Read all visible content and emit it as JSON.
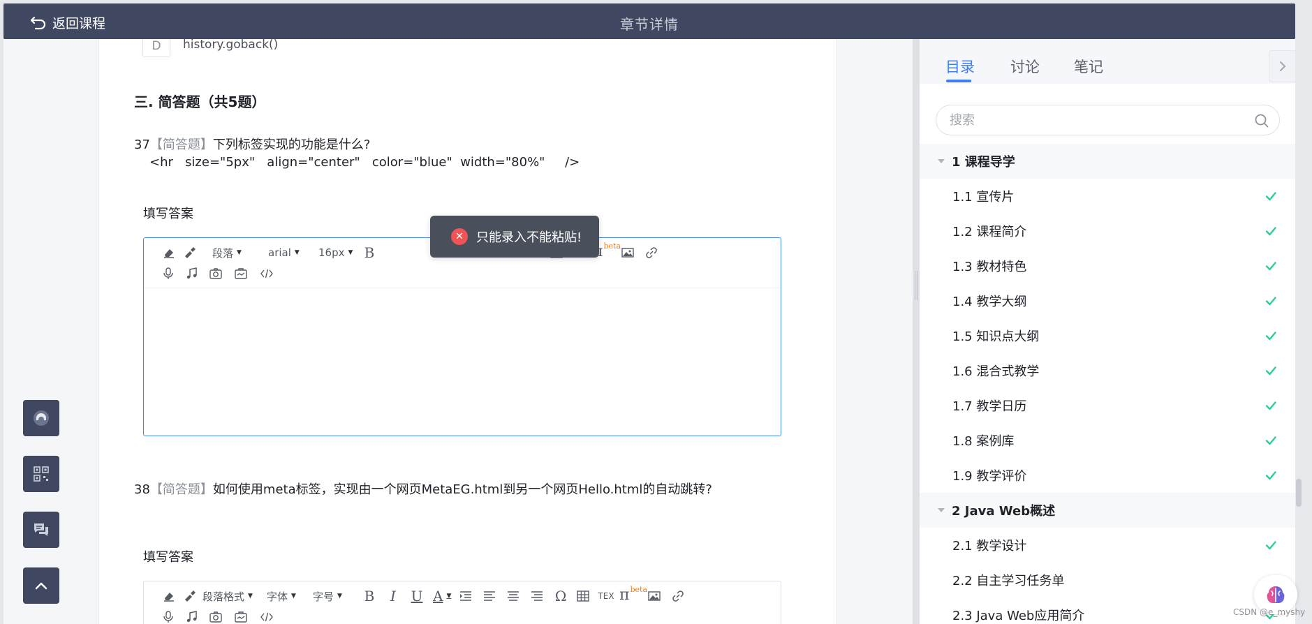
{
  "header": {
    "back_label": "返回课程",
    "title": "章节详情"
  },
  "content": {
    "prev_option": {
      "letter": "D",
      "text": "history.goback()"
    },
    "section_title": "三. 简答题（共5题）",
    "answer_label": "填写答案",
    "questions": [
      {
        "number": "37",
        "type": "【简答题】",
        "text": "下列标签实现的功能是什么?",
        "code": "<hr   size=\"5px\"   align=\"center\"   color=\"blue\"  width=\"80%\"     />"
      },
      {
        "number": "38",
        "type": "【简答题】",
        "text": "如何使用meta标签，实现由一个网页MetaEG.html到另一个网页Hello.html的自动跳转?"
      }
    ]
  },
  "editor1": {
    "paragraph": "段落",
    "font": "arial",
    "size": "16px"
  },
  "editor2": {
    "paragraph": "段落格式",
    "font": "字体",
    "size": "字号"
  },
  "toolbar_glyphs": {
    "bold": "B",
    "italic": "I",
    "underline": "U",
    "color": "A",
    "omega": "Ω",
    "tex": "TEX",
    "pi": "π",
    "beta": "beta"
  },
  "toast": {
    "message": "只能录入不能粘贴!"
  },
  "panel": {
    "tabs": [
      "目录",
      "讨论",
      "笔记"
    ],
    "active_tab": 0,
    "search_placeholder": "搜索",
    "chapters": [
      {
        "title": "1 课程导学",
        "items": [
          {
            "label": "1.1 宣传片",
            "done": true
          },
          {
            "label": "1.2 课程简介",
            "done": true
          },
          {
            "label": "1.3 教材特色",
            "done": true
          },
          {
            "label": "1.4 教学大纲",
            "done": true
          },
          {
            "label": "1.5 知识点大纲",
            "done": true
          },
          {
            "label": "1.6 混合式教学",
            "done": true
          },
          {
            "label": "1.7 教学日历",
            "done": true
          },
          {
            "label": "1.8 案例库",
            "done": true
          },
          {
            "label": "1.9 教学评价",
            "done": true
          }
        ]
      },
      {
        "title": "2 Java Web概述",
        "items": [
          {
            "label": "2.1 教学设计",
            "done": true
          },
          {
            "label": "2.2 自主学习任务单",
            "done": false
          },
          {
            "label": "2.3 Java Web应用简介",
            "done": true
          }
        ]
      }
    ]
  },
  "colors": {
    "accent": "#3d7ff3",
    "header_bg": "#3f4860",
    "check": "#2ecc8f",
    "toast_bg": "#4a4f5c",
    "error": "#f05454"
  },
  "watermark": "CSDN @e_myshy"
}
